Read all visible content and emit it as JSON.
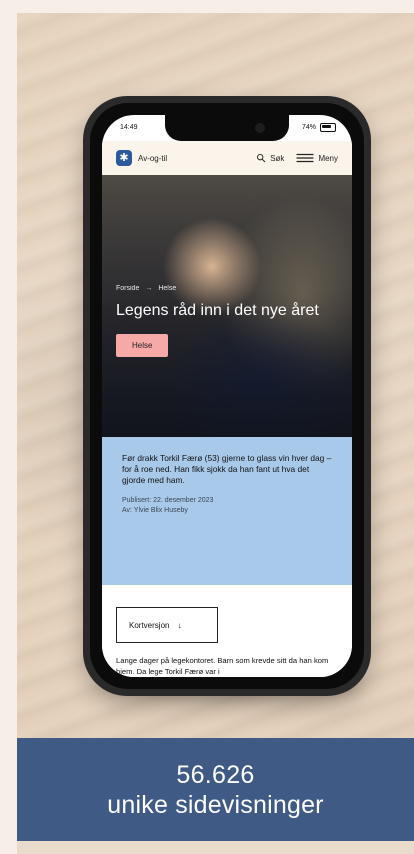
{
  "phone": {
    "status_time": "14:49",
    "battery_text": "74%"
  },
  "site": {
    "logo_text": "Av-og-til",
    "search_label": "Søk",
    "menu_label": "Meny"
  },
  "article": {
    "breadcrumb": [
      "Forside",
      "Helse"
    ],
    "title": "Legens råd inn i det nye året",
    "tag": "Helse",
    "intro": "Før drakk Torkil Færø (53) gjerne to glass vin hver dag – for å roe ned. Han fikk sjokk da han fant ut hva det gjorde med ham.",
    "published": "Publisert: 22. desember 2023",
    "author": "Av: Ylvie Blix Huseby",
    "short_version_label": "Kortversjon",
    "body_preview": "Lange dager på legekontoret. Barn som krevde sitt da han kom hjem. Da lege Torkil Færø var i"
  },
  "stats": {
    "value": "56.626",
    "label": "unike sidevisninger"
  },
  "icons": {
    "search": "search-icon",
    "menu": "menu-icon",
    "arrow_down": "arrow-down-icon",
    "logo": "logo-icon"
  },
  "colors": {
    "brand_blue": "#2b5a9f",
    "intro_blue": "#a9c9ea",
    "tag_pink": "#f6a9a6",
    "stats_bar": "#3f5a84"
  }
}
